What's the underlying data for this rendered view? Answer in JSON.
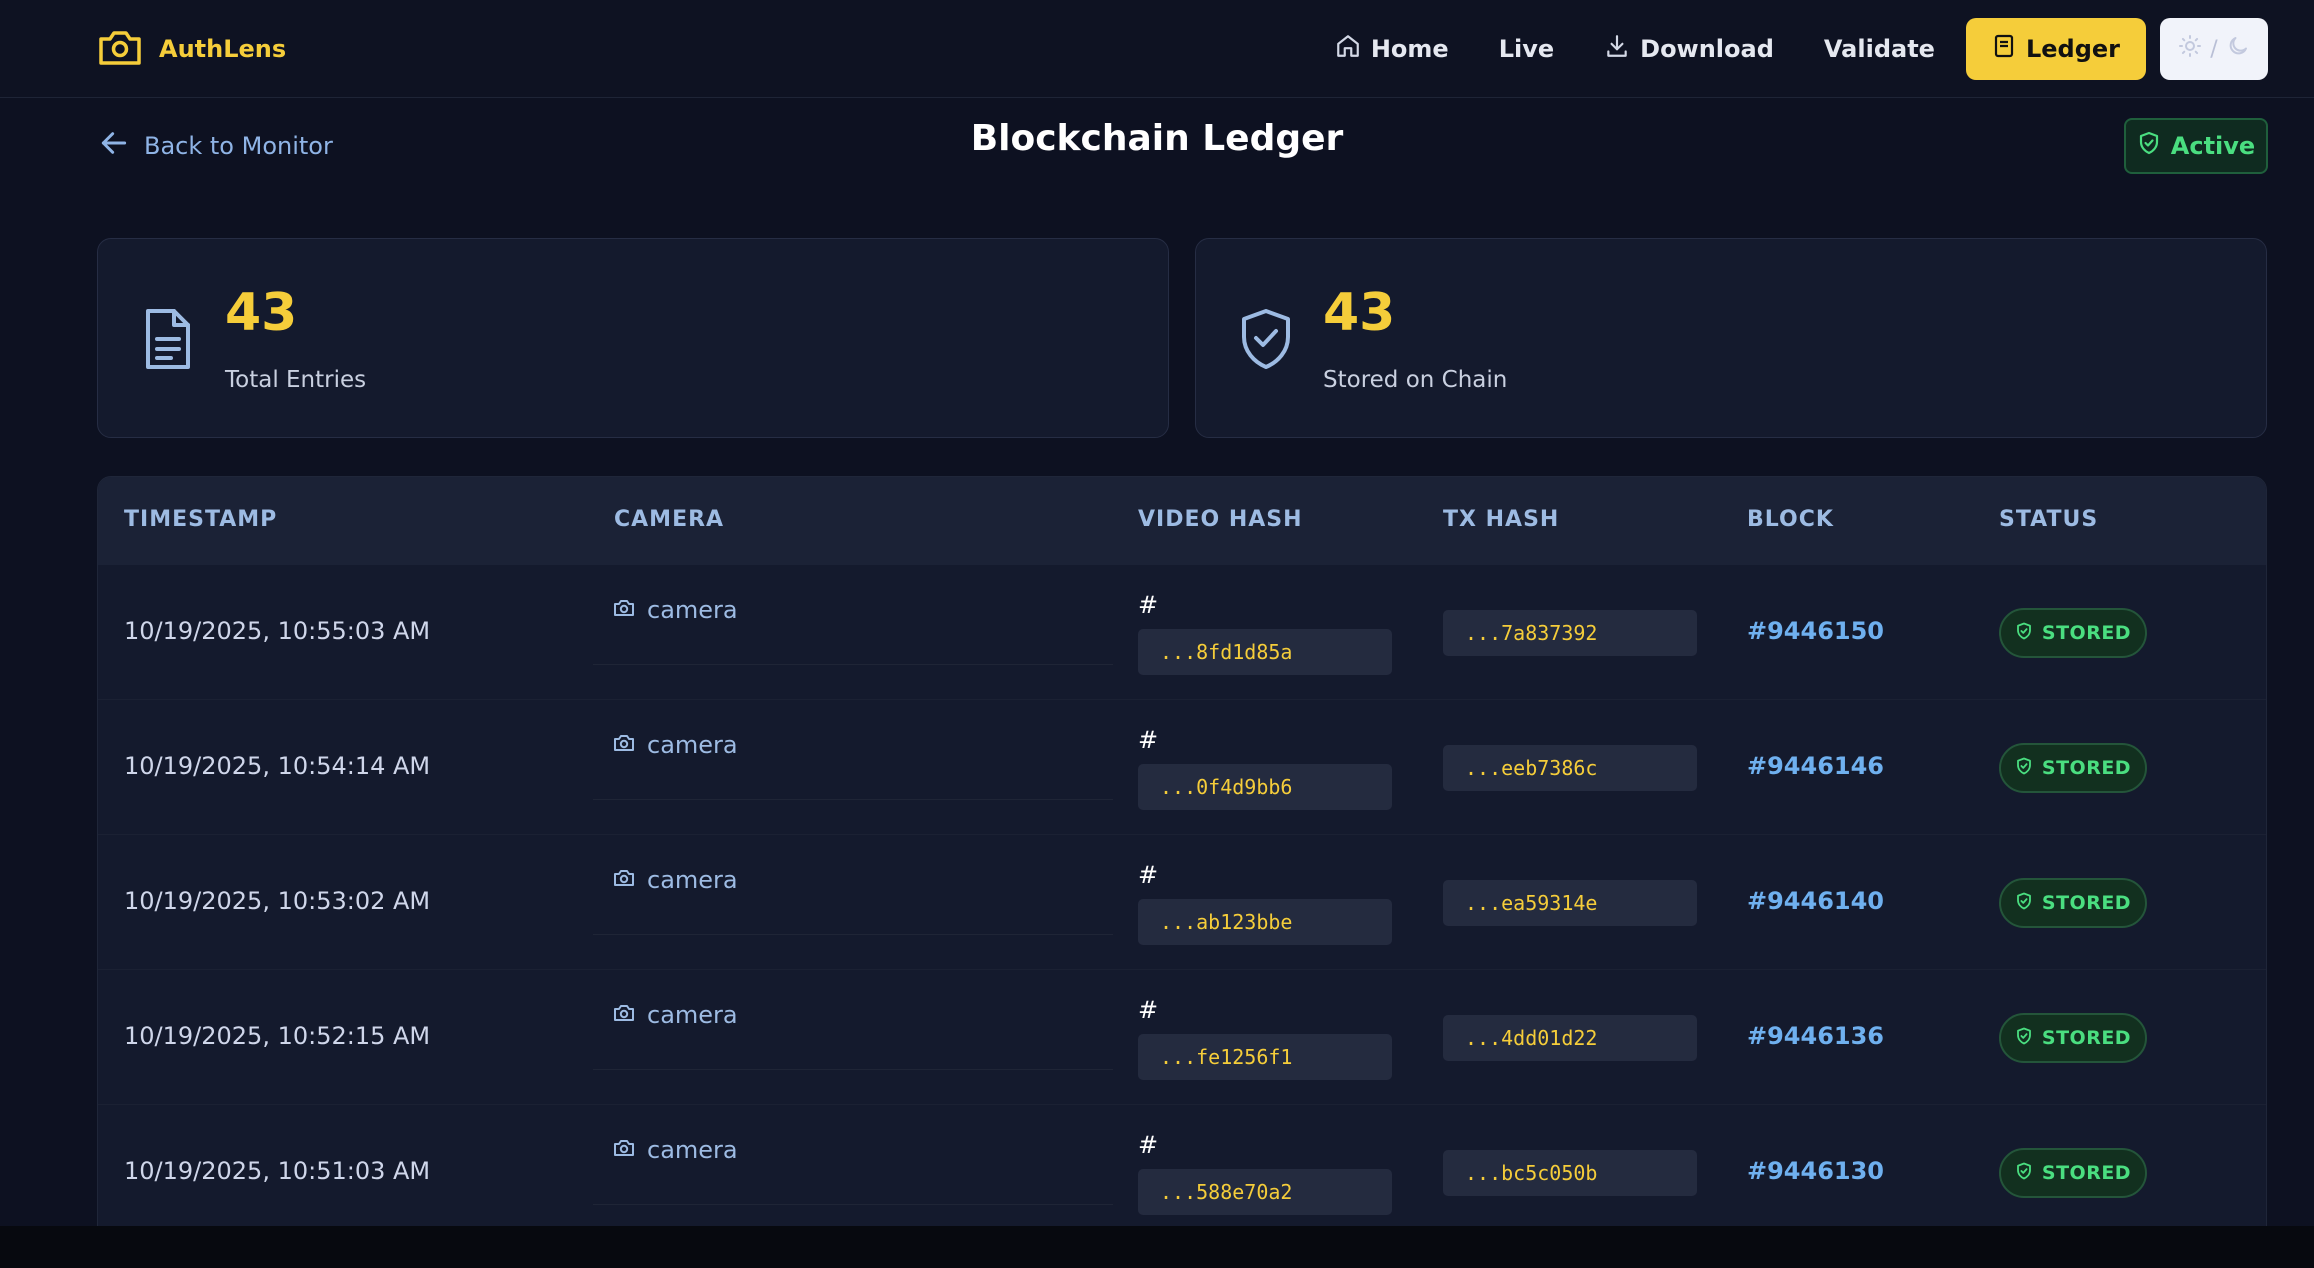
{
  "brand": {
    "name": "AuthLens"
  },
  "nav": {
    "home": "Home",
    "live": "Live",
    "download": "Download",
    "validate": "Validate",
    "ledger": "Ledger",
    "theme_separator": "/"
  },
  "header": {
    "back_label": "Back to Monitor",
    "title": "Blockchain Ledger",
    "status_label": "Active"
  },
  "stats": [
    {
      "value": "43",
      "label": "Total Entries",
      "icon": "document-icon"
    },
    {
      "value": "43",
      "label": "Stored on Chain",
      "icon": "shield-check-icon"
    }
  ],
  "table": {
    "columns": [
      "TIMESTAMP",
      "CAMERA",
      "VIDEO HASH",
      "TX HASH",
      "BLOCK",
      "STATUS"
    ],
    "rows": [
      {
        "timestamp": "10/19/2025, 10:55:03 AM",
        "camera": "camera",
        "hash_mark": "#",
        "video_hash": "...8fd1d85a",
        "tx_hash": "...7a837392",
        "block": "#9446150",
        "status": "STORED"
      },
      {
        "timestamp": "10/19/2025, 10:54:14 AM",
        "camera": "camera",
        "hash_mark": "#",
        "video_hash": "...0f4d9bb6",
        "tx_hash": "...eeb7386c",
        "block": "#9446146",
        "status": "STORED"
      },
      {
        "timestamp": "10/19/2025, 10:53:02 AM",
        "camera": "camera",
        "hash_mark": "#",
        "video_hash": "...ab123bbe",
        "tx_hash": "...ea59314e",
        "block": "#9446140",
        "status": "STORED"
      },
      {
        "timestamp": "10/19/2025, 10:52:15 AM",
        "camera": "camera",
        "hash_mark": "#",
        "video_hash": "...fe1256f1",
        "tx_hash": "...4dd01d22",
        "block": "#9446136",
        "status": "STORED"
      },
      {
        "timestamp": "10/19/2025, 10:51:03 AM",
        "camera": "camera",
        "hash_mark": "#",
        "video_hash": "...588e70a2",
        "tx_hash": "...bc5c050b",
        "block": "#9446130",
        "status": "STORED"
      }
    ]
  },
  "colors": {
    "accent": "#f5cd3a",
    "background": "#0d1121",
    "success": "#4ade80",
    "link": "#6fb0ef"
  }
}
